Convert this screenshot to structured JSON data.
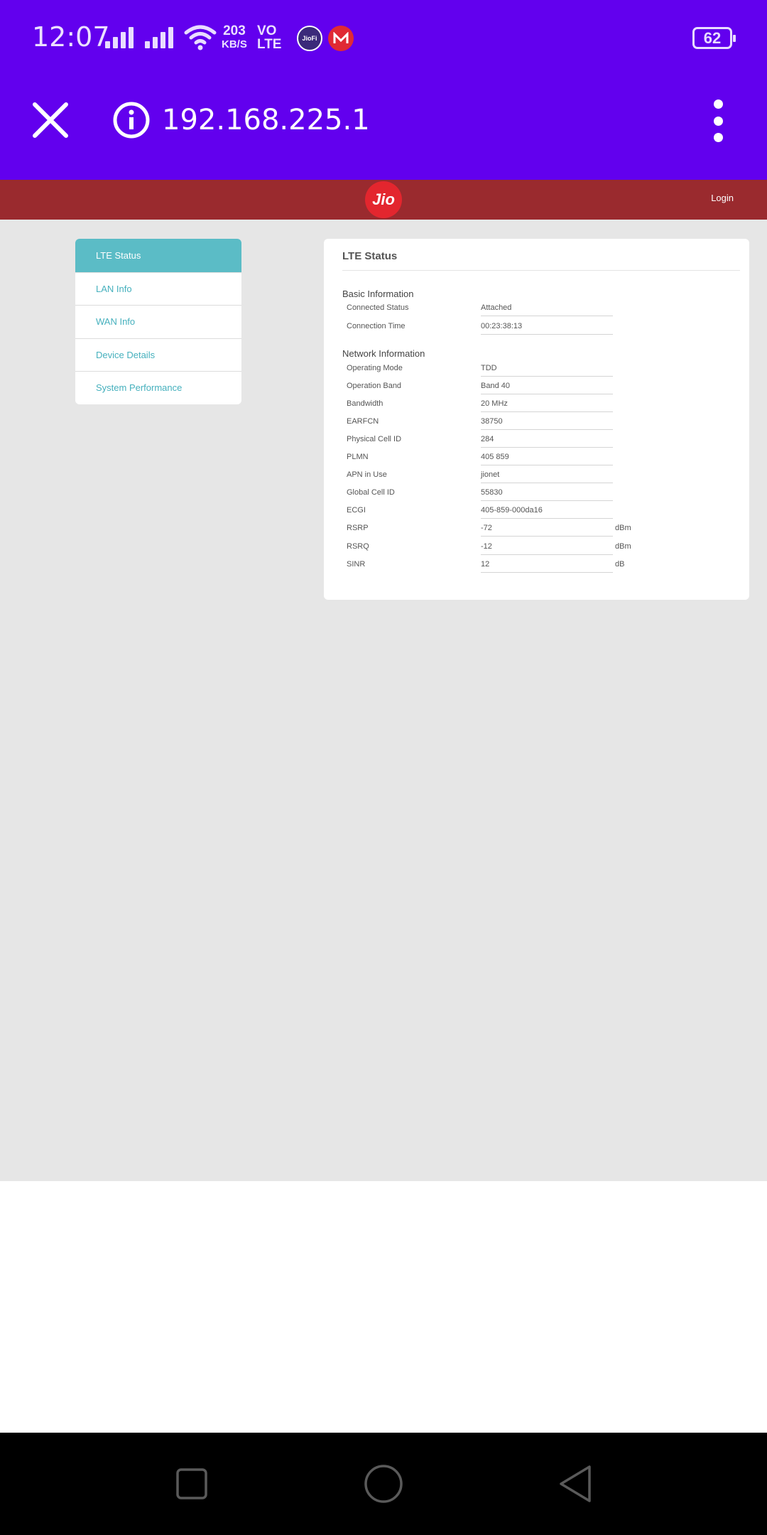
{
  "status_bar": {
    "time": "12:07",
    "net_speed": "203",
    "net_speed_unit": "KB/S",
    "volte_top": "VO",
    "volte_bottom": "LTE",
    "jiofi_label": "JioFi",
    "battery": "62",
    "icons": [
      "signal-icon",
      "wifi-icon",
      "jiofi-app-icon",
      "m-app-icon",
      "battery-icon"
    ]
  },
  "browser": {
    "url": "192.168.225.1",
    "icons": [
      "close-icon",
      "info-icon",
      "more-vert-icon"
    ]
  },
  "header": {
    "logo": "Jio",
    "login": "Login",
    "brand_color": "#9a2a2e"
  },
  "sidebar": {
    "items": [
      {
        "label": "LTE Status",
        "active": true
      },
      {
        "label": "LAN Info"
      },
      {
        "label": "WAN Info"
      },
      {
        "label": "Device Details"
      },
      {
        "label": "System Performance"
      }
    ]
  },
  "panel": {
    "title": "LTE Status",
    "basic": {
      "heading": "Basic Information",
      "rows": [
        {
          "label": "Connected Status",
          "value": "Attached"
        },
        {
          "label": "Connection Time",
          "value": "00:23:38:13"
        }
      ]
    },
    "network": {
      "heading": "Network Information",
      "rows": [
        {
          "label": "Operating Mode",
          "value": "TDD"
        },
        {
          "label": "Operation Band",
          "value": "Band 40"
        },
        {
          "label": "Bandwidth",
          "value": "20 MHz"
        },
        {
          "label": "EARFCN",
          "value": "38750"
        },
        {
          "label": "Physical Cell ID",
          "value": "284"
        },
        {
          "label": "PLMN",
          "value": "405 859"
        },
        {
          "label": "APN in Use",
          "value": "jionet"
        },
        {
          "label": "Global Cell ID",
          "value": "55830"
        },
        {
          "label": "ECGI",
          "value": "405-859-000da16"
        },
        {
          "label": "RSRP",
          "value": "-72",
          "unit": "dBm"
        },
        {
          "label": "RSRQ",
          "value": "-12",
          "unit": "dBm"
        },
        {
          "label": "SINR",
          "value": "12",
          "unit": "dB"
        }
      ]
    }
  },
  "navbar": {
    "icons": [
      "recents-icon",
      "home-icon",
      "back-icon"
    ]
  }
}
